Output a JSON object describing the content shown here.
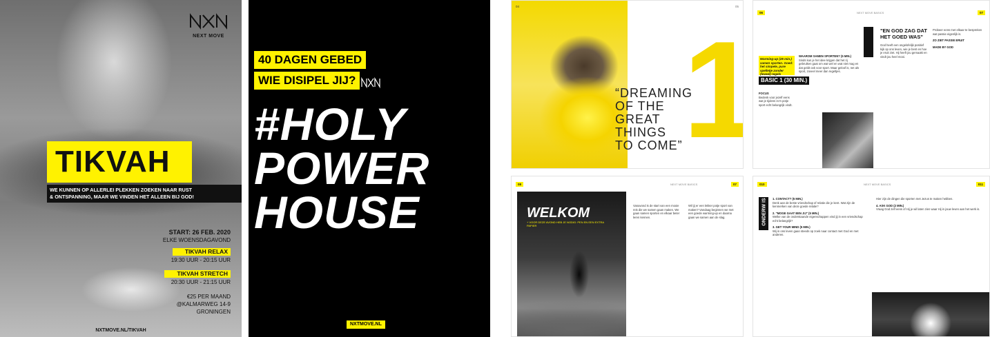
{
  "poster_tikvah": {
    "logo_text": "NEXT MOVE",
    "title": "TIKVAH",
    "tagline_1": "WE KUNNEN OP ALLERLEI PLEKKEN ZOEKEN NAAR RUST",
    "tagline_2": "& ONTSPANNING, MAAR WE VINDEN HET ALLEEN BIJ GOD!",
    "start": "START: 26 FEB. 2020",
    "weekly": "ELKE WOENSDAGAVOND",
    "relax_label": "TIKVAH RELAX",
    "relax_time": "19:30 UUR - 20:15 UUR",
    "stretch_label": "TIKVAH STRETCH",
    "stretch_time": "20:30 UUR - 21:15 UUR",
    "price": "€25 PER MAAND",
    "address": "@KALMARWEG 14-9",
    "city": "GRONINGEN",
    "url": "NXTMOVE.NL/TIKVAH"
  },
  "poster_holy": {
    "line_1": "40 DAGEN GEBED",
    "line_2": "WIE DISIPEL JIJ?",
    "big_1": "#HOLY",
    "big_2": "POWER",
    "big_3": "HOUSE",
    "url": "NXTMOVE.NL"
  },
  "spread_1": {
    "page_left": "04",
    "page_right": "05",
    "number": "1",
    "quote_1": "“DREAMING",
    "quote_2": "OF THE",
    "quote_3": "GREAT",
    "quote_4": "THINGS",
    "quote_5": "TO COME”"
  },
  "spread_2": {
    "page_left": "06",
    "page_right": "07",
    "header": "NEXT MOVE BASICS",
    "warmup": "Warming-up (25 min.) samen sporten. Goed: het simpele, pure spelletje zonder (teveel) regels sporten.",
    "basic": "BASIC 1 (30 MIN.)",
    "col1_heading": "WAAROM SAMEN SPORTEN? (5 MIN.)",
    "col1_text": "Sinds kun je het idee krijgen dat het rij gebruiken gaat om wat wel en wat niet mag en dat geldt ook voor sport. Maar geloof is, net als sport, zoveel meer dan regeltjes.",
    "focus_label": "FOCUS",
    "focus_text": "Bedenk voor jezelf eens wat je tijdens zo'n potje sport echt belangrijk vindt.",
    "ondrw": "ONDERW IS",
    "god_title_1": "\"EN GOD ZAG DAT",
    "god_title_2": "HET GOED WAS\"",
    "god_text": "God heeft een ongelofelijk positief kijk op ons leven, wie je bent en hoe je eruit ziet. Hij heeft jou gemaakt en vindt jou heel mooi.",
    "col4_text": "Probeer eens met elkaar te bespreken wat passie eigenlijk is.",
    "col4_heading": "ZO ZIET PASSIE ERUIT",
    "col4_heading_2": "MADE BY GOD"
  },
  "spread_3": {
    "page_left": "08",
    "page_right": "07",
    "header": "NEXT MOVE BASICS",
    "welkom": "WELKOM",
    "welkom_sub": "+ VOOR DEZE AVOND HEB JE NODIG: PEN EN EEN EXTRA PAPIER",
    "col_a": "Vanavond is de start van een mooie reis die we samen gaan maken. We gaan samen sporten en elkaar beter leren kennen.",
    "col_b": "Wil jij er een lekker potje sport van maken? Vandaag beginnen we met een goede warming-up en daarna gaan we samen aan de slag."
  },
  "spread_4": {
    "page_left": "010",
    "page_right": "011",
    "header": "NEXT MOVE BASICS",
    "ondrw": "ONDERW IS",
    "item_1": "1. CONTACT? (5 MIN.)",
    "item_1_text": "Denk aan de beste vriendschap of relatie die je kent. Wat zijn de kenmerken van deze goede relatie?",
    "item_2": "2. \"MOGE GAAT EEN JIJ\" (5 MIN.)",
    "item_2_text": "Welke van de onderstaande eigenschappen vind jij in een vriendschap echt belangrijk?",
    "item_3": "3. GET YOUR MIND (5 MIN.)",
    "item_3_text": "Wij in ons leven gaan steeds op zoek naar contact met God en met anderen.",
    "right_a": "Hier zijn de dingen die sporten met Jezus te maken hebben.",
    "right_heading": "4. ASK GOD (2 MIN.)",
    "right_text": "Vraag God zelf eens of Hij je wil laten zien waar Hij in jouw leven aan het werk is."
  }
}
